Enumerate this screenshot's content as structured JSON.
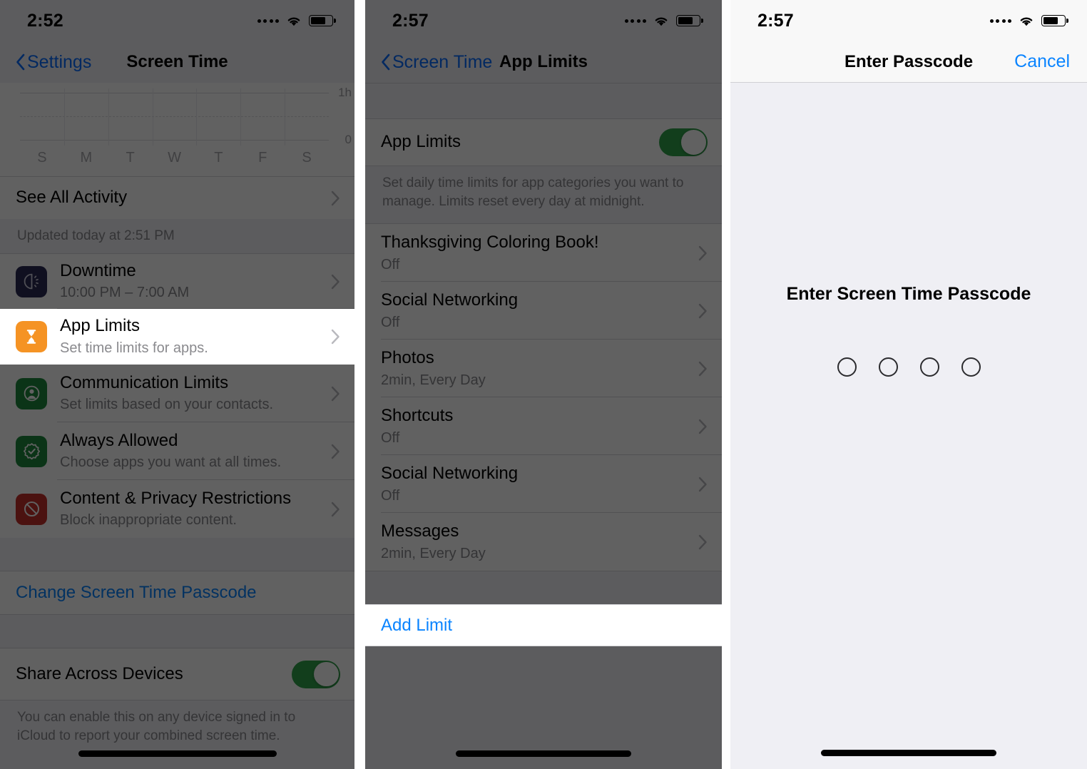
{
  "panels": {
    "screen_time": {
      "status": {
        "time": "2:52",
        "cellular_icon": "cellular-dots-icon",
        "wifi_icon": "wifi-icon",
        "battery_icon": "battery-icon"
      },
      "nav": {
        "back_label": "Settings",
        "title": "Screen Time",
        "back_icon": "chevron-left-icon"
      },
      "see_all_activity": "See All Activity",
      "updated_note": "Updated today at 2:51 PM",
      "items": [
        {
          "title": "Downtime",
          "subtitle": "10:00 PM – 7:00 AM",
          "icon": "downtime-moon-icon",
          "icon_color": "#2b2a55",
          "highlighted": false
        },
        {
          "title": "App Limits",
          "subtitle": "Set time limits for apps.",
          "icon": "hourglass-icon",
          "icon_color": "#f59324",
          "highlighted": true
        },
        {
          "title": "Communication Limits",
          "subtitle": "Set limits based on your contacts.",
          "icon": "person-circle-icon",
          "icon_color": "#1f8a3d",
          "highlighted": false
        },
        {
          "title": "Always Allowed",
          "subtitle": "Choose apps you want at all times.",
          "icon": "checkmark-seal-icon",
          "icon_color": "#1f8a3d",
          "highlighted": false
        },
        {
          "title": "Content & Privacy Restrictions",
          "subtitle": "Block inappropriate content.",
          "icon": "no-entry-icon",
          "icon_color": "#c4302b",
          "highlighted": false
        }
      ],
      "change_passcode_label": "Change Screen Time Passcode",
      "share": {
        "label": "Share Across Devices",
        "toggle_on": true,
        "footer": "You can enable this on any device signed in to iCloud to report your combined screen time."
      }
    },
    "app_limits": {
      "status": {
        "time": "2:57",
        "cellular_icon": "cellular-dots-icon",
        "wifi_icon": "wifi-icon",
        "battery_icon": "battery-icon"
      },
      "nav": {
        "back_label": "Screen Time",
        "title": "App Limits",
        "back_icon": "chevron-left-icon"
      },
      "master": {
        "label": "App Limits",
        "toggle_on": true,
        "footer": "Set daily time limits for app categories you want to manage. Limits reset every day at midnight."
      },
      "limits": [
        {
          "title": "Thanksgiving Coloring Book!",
          "value": "Off"
        },
        {
          "title": "Social Networking",
          "value": "Off"
        },
        {
          "title": "Photos",
          "value": "2min, Every Day"
        },
        {
          "title": "Shortcuts",
          "value": "Off"
        },
        {
          "title": "Social Networking",
          "value": "Off"
        },
        {
          "title": "Messages",
          "value": "2min, Every Day"
        }
      ],
      "add_limit_label": "Add Limit"
    },
    "passcode": {
      "status": {
        "time": "2:57",
        "cellular_icon": "cellular-dots-icon",
        "wifi_icon": "wifi-icon",
        "battery_icon": "battery-icon"
      },
      "nav": {
        "title": "Enter Passcode",
        "cancel_label": "Cancel"
      },
      "prompt": "Enter Screen Time Passcode",
      "dot_count": 4,
      "dots_filled": 0
    }
  },
  "colors": {
    "accent_blue": "#0a84ff",
    "toggle_green": "#30a24a",
    "scrim": "rgba(0,0,0,0.62)",
    "group_bg": "#f2f2f7",
    "passcode_bg": "#efeff4"
  },
  "chart_data": {
    "type": "bar",
    "title": "",
    "categories": [
      "S",
      "M",
      "T",
      "W",
      "T",
      "F",
      "S"
    ],
    "values": [
      0,
      0,
      0,
      0,
      0,
      0,
      0
    ],
    "ytick_labels": [
      "1h",
      "0"
    ],
    "ylim": [
      0,
      1
    ],
    "xlabel": "",
    "ylabel": "",
    "grid": true,
    "legend": "none"
  }
}
